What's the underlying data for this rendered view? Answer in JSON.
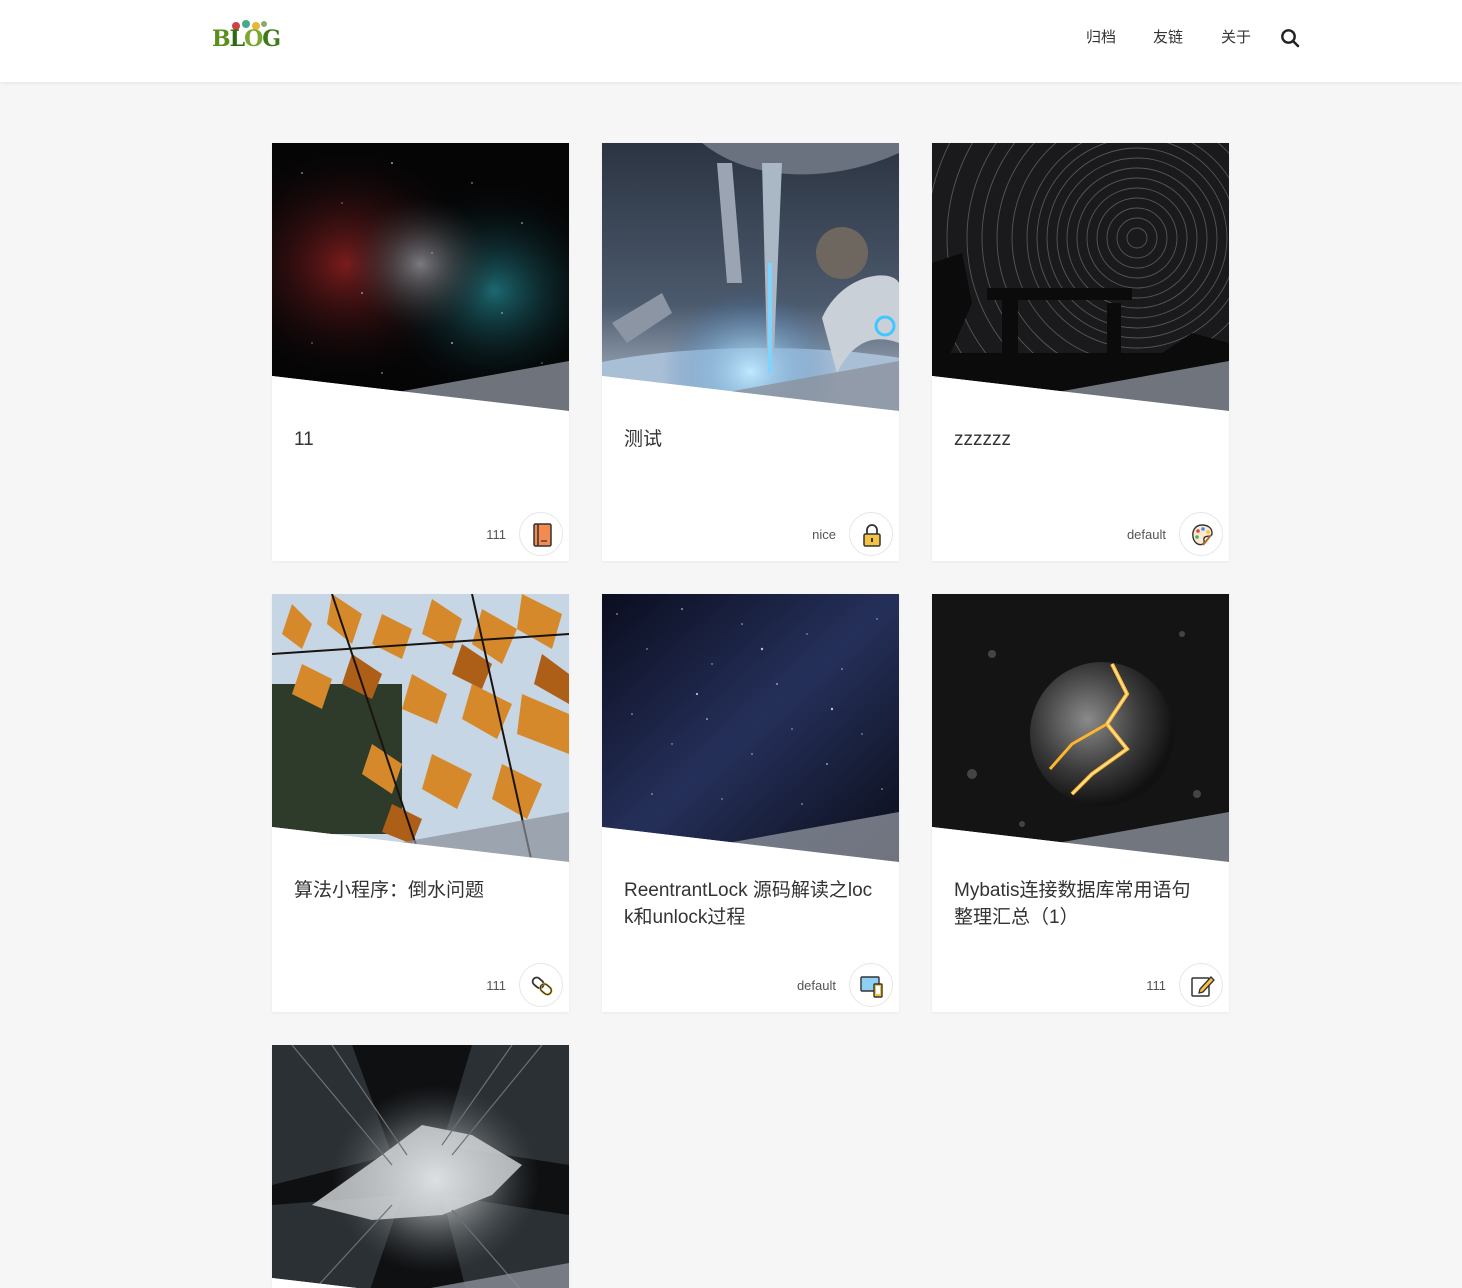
{
  "header": {
    "logo_alt": "BLOG",
    "nav": [
      {
        "label": "归档"
      },
      {
        "label": "友链"
      },
      {
        "label": "关于"
      }
    ]
  },
  "posts": [
    {
      "title": "11",
      "tag": "111",
      "category_icon": "notebook-icon",
      "cover": "nebula"
    },
    {
      "title": "测试",
      "tag": "nice",
      "category_icon": "lock-icon",
      "cover": "spaceship"
    },
    {
      "title": "zzzzzz",
      "tag": "default",
      "category_icon": "palette-icon",
      "cover": "star-trails"
    },
    {
      "title": "算法小程序：倒水问题",
      "tag": "111",
      "category_icon": "link-icon",
      "cover": "autumn-leaves"
    },
    {
      "title": "ReentrantLock 源码解读之lock和unlock过程",
      "tag": "default",
      "category_icon": "devices-icon",
      "cover": "starfield"
    },
    {
      "title": "Mybatis连接数据库常用语句整理汇总（1）",
      "tag": "111",
      "category_icon": "edit-icon",
      "cover": "cracked-planet"
    },
    {
      "title": "",
      "tag": "",
      "category_icon": "",
      "cover": "city-skyline"
    }
  ]
}
